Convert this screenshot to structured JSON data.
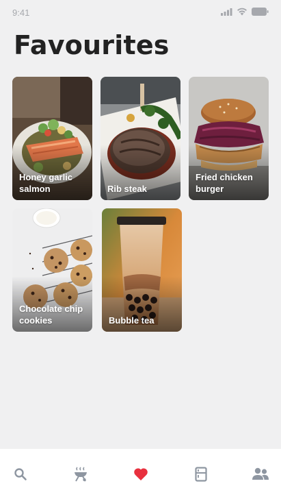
{
  "status_bar": {
    "time": "9:41",
    "icons": [
      "signal-icon",
      "wifi-icon",
      "battery-icon"
    ]
  },
  "page": {
    "title": "Favourites"
  },
  "favourites": [
    {
      "label": "Honey garlic\nsalmon",
      "image": "salmon-dish"
    },
    {
      "label": "Rib steak",
      "image": "steak-dish"
    },
    {
      "label": "Fried chicken\nburger",
      "image": "burger-dish"
    },
    {
      "label": "Chocolate chip\ncookies",
      "image": "cookies-dish"
    },
    {
      "label": "Bubble tea",
      "image": "bubble-tea-drink"
    }
  ],
  "bottom_nav": {
    "items": [
      {
        "name": "search",
        "icon": "search-icon",
        "active": false
      },
      {
        "name": "grill",
        "icon": "grill-icon",
        "active": false
      },
      {
        "name": "favourites",
        "icon": "heart-icon",
        "active": true
      },
      {
        "name": "fridge",
        "icon": "fridge-icon",
        "active": false
      },
      {
        "name": "community",
        "icon": "people-icon",
        "active": false
      }
    ]
  },
  "colors": {
    "background": "#f0f0f1",
    "active_icon": "#e8303e",
    "inactive_icon": "#8e96a1",
    "status_text": "#a6a8ad"
  }
}
